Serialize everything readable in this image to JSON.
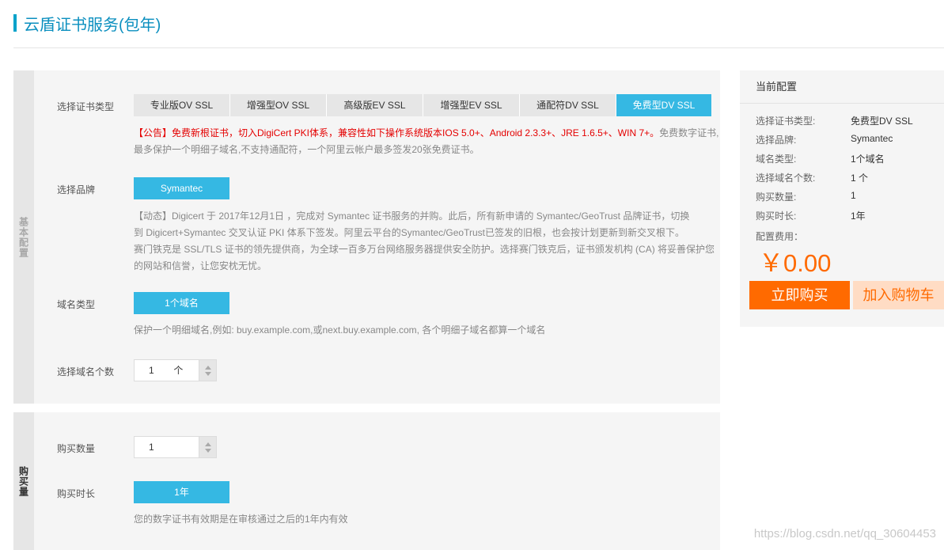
{
  "page": {
    "title": "云盾证书服务(包年)"
  },
  "basic": {
    "side_label": "基本配置",
    "cert_type": {
      "label": "选择证书类型",
      "options": [
        "专业版OV SSL",
        "增强型OV SSL",
        "高级版EV SSL",
        "增强型EV SSL",
        "通配符DV SSL",
        "免费型DV SSL"
      ],
      "selected": "免费型DV SSL"
    },
    "notice_red": "【公告】免费新根证书，切入DigiCert PKI体系，兼容性如下操作系统版本IOS 5.0+、Android 2.3.3+、JRE 1.6.5+、WIN 7+。",
    "notice_gray": "免费数字证书,最多保护一个明细子域名,不支持通配符，一个阿里云帐户最多签发20张免费证书。",
    "brand": {
      "label": "选择品牌",
      "selected": "Symantec",
      "news_line1": "【动态】Digicert 于 2017年12月1日 ，完成对 Symantec 证书服务的并购。此后，所有新申请的 Symantec/GeoTrust 品牌证书，切换",
      "news_line2": "到 Digicert+Symantec 交叉认证 PKI 体系下签发。阿里云平台的Symantec/GeoTrust已签发的旧根，也会按计划更新到新交叉根下。",
      "news_line3": "赛门铁克是 SSL/TLS 证书的领先提供商，为全球一百多万台网络服务器提供安全防护。选择赛门铁克后，证书颁发机构 (CA) 将妥善保护您",
      "news_line4": "的网站和信誉，让您安枕无忧。"
    },
    "domain_type": {
      "label": "域名类型",
      "selected": "1个域名",
      "desc": "保护一个明细域名,例如: buy.example.com,或next.buy.example.com, 各个明细子域名都算一个域名"
    },
    "domain_count": {
      "label": "选择域名个数",
      "value": "1",
      "unit": "个"
    }
  },
  "buy": {
    "side_label": "购买量",
    "quantity": {
      "label": "购买数量",
      "value": "1"
    },
    "duration": {
      "label": "购买时长",
      "selected": "1年",
      "desc": "您的数字证书有效期是在审核通过之后的1年内有效"
    }
  },
  "config": {
    "title": "当前配置",
    "rows": [
      {
        "label": "选择证书类型:",
        "value": "免费型DV SSL"
      },
      {
        "label": "选择品牌:",
        "value": "Symantec"
      },
      {
        "label": "域名类型:",
        "value": "1个域名"
      },
      {
        "label": "选择域名个数:",
        "value": "1 个"
      },
      {
        "label": "购买数量:",
        "value": "1"
      },
      {
        "label": "购买时长:",
        "value": "1年"
      }
    ],
    "fee_label": "配置费用：",
    "price": "￥0.00",
    "buy_now": "立即购买",
    "add_cart": "加入购物车"
  },
  "watermark": "https://blog.csdn.net/qq_30604453",
  "colors": {
    "accent": "#35b8e3",
    "orange": "#ff6a00",
    "red_notice": "#e40000"
  }
}
